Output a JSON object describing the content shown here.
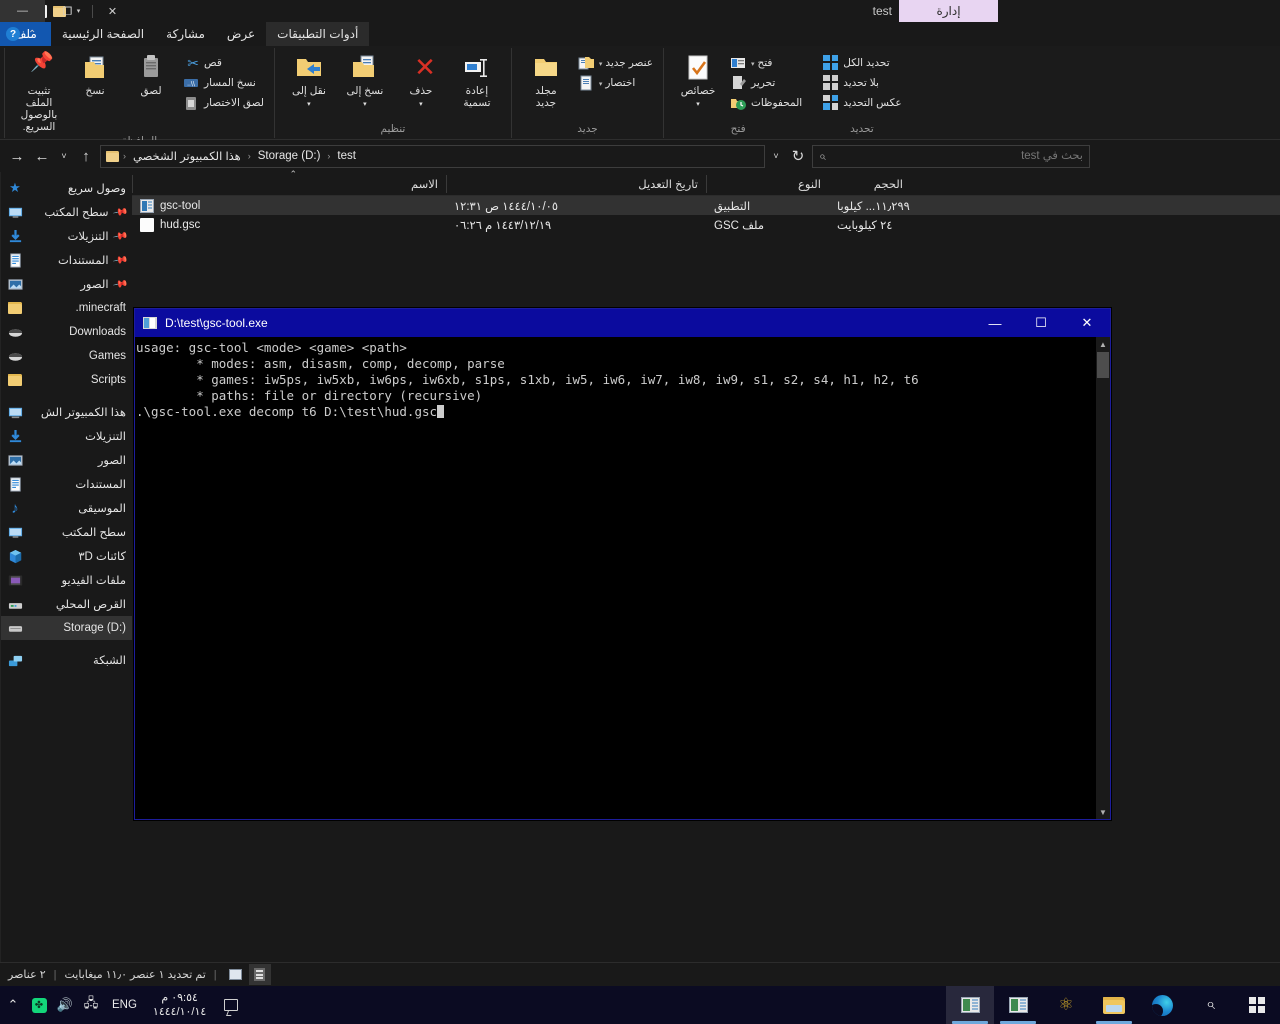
{
  "explorer": {
    "window_title": "test",
    "contextual_tab": "إدارة",
    "quick_access": {
      "folder_icon": "new-folder-icon",
      "properties_icon": "properties-icon",
      "customize_caret": "▾"
    },
    "window_controls": {
      "minimize": "—",
      "restore": "❐",
      "close": "✕"
    },
    "tabs": [
      {
        "id": "file",
        "label": "ملف"
      },
      {
        "id": "home",
        "label": "الصفحة الرئيسية"
      },
      {
        "id": "share",
        "label": "مشاركة"
      },
      {
        "id": "view",
        "label": "عرض"
      },
      {
        "id": "apptools",
        "label": "أدوات التطبيقات"
      }
    ],
    "help": {
      "icon": "help-icon",
      "glyph": "?",
      "collapse": "⌃"
    },
    "ribbon": {
      "groups": [
        {
          "name": "clipboard",
          "label": "الحافظة",
          "big": [
            {
              "label": "تثبيت الملف بالوصول السريع.",
              "icon": "pin-icon"
            },
            {
              "label": "نسخ",
              "icon": "copy-icon"
            },
            {
              "label": "لصق",
              "icon": "paste-icon"
            }
          ],
          "small": [
            {
              "label": "قص",
              "icon": "cut-icon"
            },
            {
              "label": "نسخ المسار",
              "icon": "copy-path-icon"
            },
            {
              "label": "لصق الاختصار",
              "icon": "paste-shortcut-icon"
            }
          ]
        },
        {
          "name": "organize",
          "label": "تنظيم",
          "big": [
            {
              "label": "نقل إلى",
              "caret": "▾",
              "icon": "move-to-icon"
            },
            {
              "label": "نسخ إلى",
              "caret": "▾",
              "icon": "copy-to-icon"
            },
            {
              "label": "حذف",
              "caret": "▾",
              "icon": "delete-icon"
            },
            {
              "label": "إعادة تسمية",
              "icon": "rename-icon"
            }
          ]
        },
        {
          "name": "new",
          "label": "جديد",
          "big": [
            {
              "label": "مجلد جديد",
              "icon": "new-folder-icon"
            }
          ],
          "small": [
            {
              "label": "عنصر جديد",
              "caret": "▾",
              "icon": "new-item-icon"
            },
            {
              "label": "اختصار",
              "caret": "▾",
              "icon": "shortcut-icon"
            }
          ]
        },
        {
          "name": "open",
          "label": "فتح",
          "big": [
            {
              "label": "خصائص",
              "caret": "▾",
              "icon": "properties-icon"
            }
          ],
          "small": [
            {
              "label": "فتح",
              "caret": "▾",
              "icon": "open-icon"
            },
            {
              "label": "تحرير",
              "icon": "edit-icon"
            },
            {
              "label": "المحفوظات",
              "icon": "history-icon"
            }
          ]
        },
        {
          "name": "select",
          "label": "تحديد",
          "small": [
            {
              "label": "تحديد الكل",
              "icon": "select-all-icon"
            },
            {
              "label": "بلا تحديد",
              "icon": "select-none-icon"
            },
            {
              "label": "عكس التحديد",
              "icon": "invert-selection-icon"
            }
          ]
        }
      ]
    },
    "address": {
      "back": "←",
      "forward": "→",
      "up": "↑",
      "recent_caret": "˅",
      "refresh": "↻",
      "history_caret": "˅",
      "folder_icon": "folder-icon",
      "breadcrumbs": [
        "هذا الكمبيوتر الشخصي",
        "Storage (D:)",
        "test"
      ],
      "separator": "‹"
    },
    "search": {
      "placeholder": "بحث في test",
      "value": "",
      "icon": "search-icon"
    },
    "nav_pane": {
      "groups": [
        {
          "items": [
            {
              "label": "وصول سريع",
              "icon": "star-icon",
              "pinned": false,
              "selected": false
            },
            {
              "label": "سطح المكتب",
              "icon": "desktop-icon",
              "pinned": true,
              "selected": false
            },
            {
              "label": "التنزيلات",
              "icon": "downloads-icon",
              "pinned": true,
              "selected": false
            },
            {
              "label": "المستندات",
              "icon": "documents-icon",
              "pinned": true,
              "selected": false
            },
            {
              "label": "الصور",
              "icon": "pictures-icon",
              "pinned": true,
              "selected": false
            },
            {
              "label": "minecraft.",
              "icon": "folder-icon",
              "pinned": false,
              "selected": false
            },
            {
              "label": "Downloads",
              "icon": "drive-folder-icon",
              "pinned": false,
              "selected": false
            },
            {
              "label": "Games",
              "icon": "drive-folder-icon",
              "pinned": false,
              "selected": false
            },
            {
              "label": "Scripts",
              "icon": "folder-icon",
              "pinned": false,
              "selected": false
            }
          ]
        },
        {
          "items": [
            {
              "label": "هذا الكمبيوتر الش",
              "icon": "this-pc-icon",
              "pinned": false,
              "selected": false
            },
            {
              "label": "التنزيلات",
              "icon": "downloads-icon",
              "pinned": false,
              "selected": false
            },
            {
              "label": "الصور",
              "icon": "pictures-icon",
              "pinned": false,
              "selected": false
            },
            {
              "label": "المستندات",
              "icon": "documents-icon",
              "pinned": false,
              "selected": false
            },
            {
              "label": "الموسيقى",
              "icon": "music-icon",
              "pinned": false,
              "selected": false
            },
            {
              "label": "سطح المكتب",
              "icon": "desktop-icon",
              "pinned": false,
              "selected": false
            },
            {
              "label": "كائنات ٣D",
              "icon": "3d-objects-icon",
              "pinned": false,
              "selected": false
            },
            {
              "label": "ملفات الفيديو",
              "icon": "videos-icon",
              "pinned": false,
              "selected": false
            },
            {
              "label": "القرص المحلي",
              "icon": "local-disk-icon",
              "pinned": false,
              "selected": false
            },
            {
              "label": "Storage (D:)",
              "icon": "drive-icon",
              "pinned": false,
              "selected": true
            }
          ]
        },
        {
          "items": [
            {
              "label": "الشبكة",
              "icon": "network-icon",
              "pinned": false,
              "selected": false
            }
          ]
        }
      ]
    },
    "columns": [
      {
        "key": "name",
        "label": "الاسم",
        "sorted": true,
        "sort_glyph": "⌃"
      },
      {
        "key": "date",
        "label": "تاريخ التعديل"
      },
      {
        "key": "type",
        "label": "النوع"
      },
      {
        "key": "size",
        "label": "الحجم"
      }
    ],
    "rows": [
      {
        "name": "gsc-tool",
        "date": "١٤٤٤/١٠/٠٥ ص ١٢:٣١",
        "type": "التطبيق",
        "size": "١١٫٢٩٩... كيلوبا",
        "icon": "exe-file-icon",
        "selected": true
      },
      {
        "name": "hud.gsc",
        "date": "١٤٤٣/١٢/١٩ م ٠٦:٢٦",
        "type": "ملف GSC",
        "size": "٢٤ كيلوبايت",
        "icon": "gsc-file-icon",
        "selected": false
      }
    ],
    "status": {
      "items_count": "٢ عناصر",
      "selection": "تم تحديد ١ عنصر ١١٫٠ ميغابايت",
      "separator": "|",
      "view_thumbnails": "thumbnails-view-icon",
      "view_details": "details-view-icon"
    }
  },
  "console": {
    "title": "D:\\test\\gsc-tool.exe",
    "icon": "console-icon",
    "controls": {
      "minimize": "—",
      "maximize": "☐",
      "close": "✕"
    },
    "output": "usage: gsc-tool <mode> <game> <path>\n        * modes: asm, disasm, comp, decomp, parse\n        * games: iw5ps, iw5xb, iw6ps, iw6xb, s1ps, s1xb, iw5, iw6, iw7, iw8, iw9, s1, s2, s4, h1, h2, t6\n        * paths: file or directory (recursive)\n.\\gsc-tool.exe decomp t6 D:\\test\\hud.gsc",
    "scrollbar": {
      "up": "▲",
      "down": "▼"
    }
  },
  "taskbar": {
    "start": "start-button",
    "search": "search-icon",
    "buttons": [
      {
        "name": "edge",
        "icon": "edge-icon",
        "running": false
      },
      {
        "name": "file-explorer",
        "icon": "file-explorer-icon",
        "running": true
      },
      {
        "name": "atom",
        "icon": "atom-icon",
        "running": false
      },
      {
        "name": "gsc-tool-console",
        "icon": "console-window-icon",
        "running": true
      },
      {
        "name": "gsc-tool-console-active",
        "icon": "console-window-icon",
        "running": true,
        "active": true
      }
    ],
    "tray": {
      "chevron": "⌃",
      "green_badge": "sync-icon",
      "volume": "volume-icon",
      "network": "network-icon",
      "language": "ENG",
      "time": "٠٩:٥٤ م",
      "date": "١٤٤٤/١٠/١٤",
      "notifications": "notifications-icon"
    }
  },
  "colors": {
    "accent": "#1257b0",
    "console_title": "#0b0b9e",
    "contextual_tab": "#e8d5f2",
    "taskbar": "#0b0b22",
    "selection": "#333333"
  }
}
